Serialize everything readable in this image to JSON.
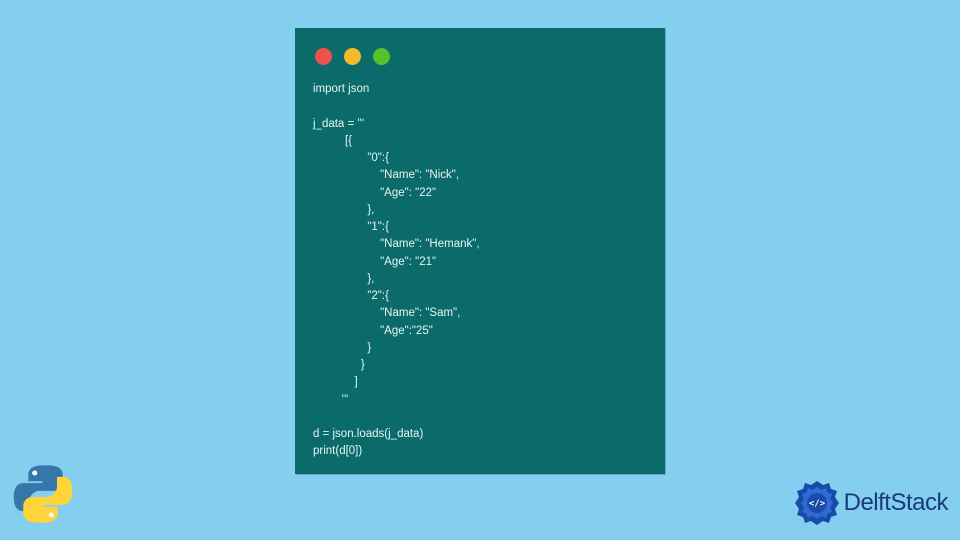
{
  "code_content": "import json\n\nj_data = '''\n          [{\n                 \"0\":{\n                     \"Name\": \"Nick\",\n                     \"Age\": \"22\"\n                 },\n                 \"1\":{\n                     \"Name\": \"Hemank\",\n                     \"Age\": \"21\"\n                 },\n                 \"2\":{\n                     \"Name\": \"Sam\",\n                     \"Age\":\"25\"\n                 }\n               }\n             ]\n         '''\n\nd = json.loads(j_data)\nprint(d[0])",
  "brand": {
    "name": "DelftStack"
  },
  "icons": {
    "python": "python-logo",
    "ds_badge": "delftstack-badge"
  }
}
